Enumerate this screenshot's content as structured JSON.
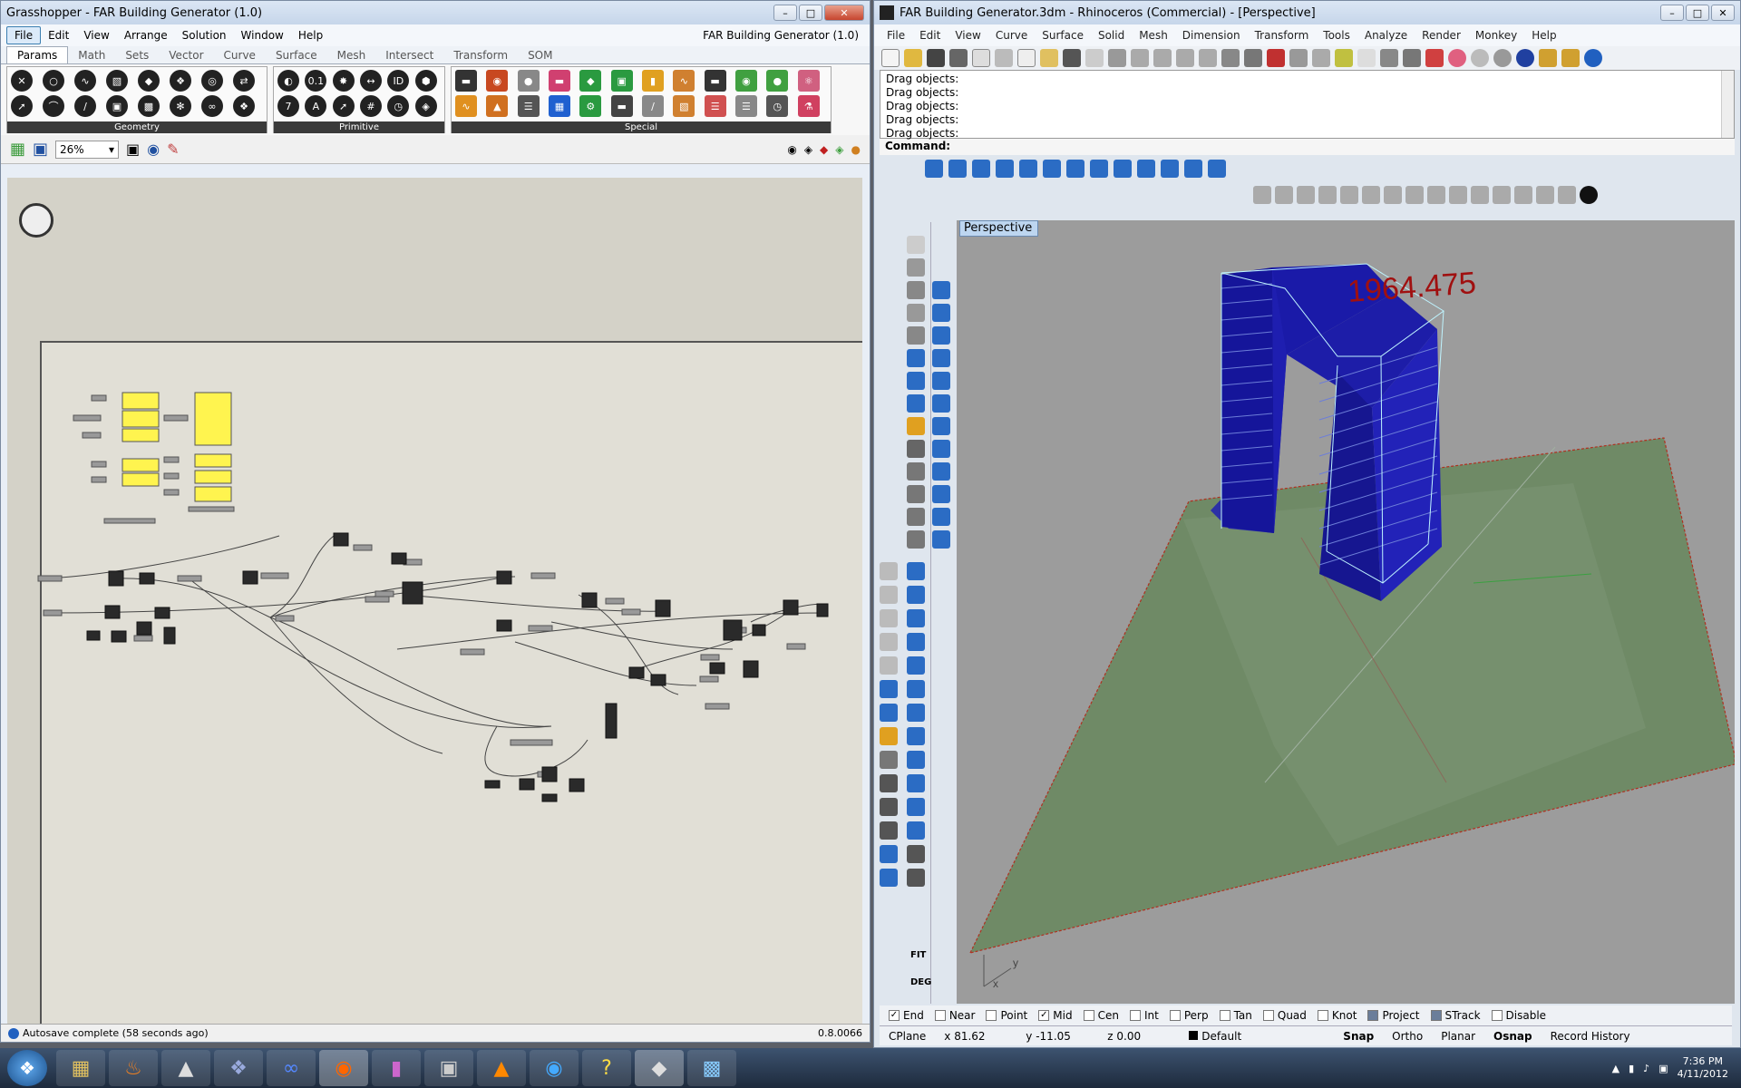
{
  "grasshopper": {
    "title": "Grasshopper - FAR Building Generator (1.0)",
    "doc_name": "FAR Building Generator (1.0)",
    "menu": [
      "File",
      "Edit",
      "View",
      "Arrange",
      "Solution",
      "Window",
      "Help"
    ],
    "tabs": [
      "Params",
      "Math",
      "Sets",
      "Vector",
      "Curve",
      "Surface",
      "Mesh",
      "Intersect",
      "Transform",
      "SOM"
    ],
    "ribbon_groups": [
      "Geometry",
      "Primitive",
      "Special"
    ],
    "zoom": "26%",
    "status": "Autosave complete (58 seconds ago)",
    "version": "0.8.0066"
  },
  "rhino": {
    "title": "FAR Building Generator.3dm - Rhinoceros (Commercial) - [Perspective]",
    "menu": [
      "File",
      "Edit",
      "View",
      "Curve",
      "Surface",
      "Solid",
      "Mesh",
      "Dimension",
      "Transform",
      "Tools",
      "Analyze",
      "Render",
      "Monkey",
      "Help"
    ],
    "history": [
      "Drag objects:",
      "Drag objects:",
      "Drag objects:",
      "Drag objects:",
      "Drag objects:"
    ],
    "command_label": "Command:",
    "viewport": "Perspective",
    "measure": "1964.475",
    "axis_y": "y",
    "axis_x": "x",
    "osnaps": [
      {
        "label": "End",
        "checked": true
      },
      {
        "label": "Near",
        "checked": false
      },
      {
        "label": "Point",
        "checked": false
      },
      {
        "label": "Mid",
        "checked": true
      },
      {
        "label": "Cen",
        "checked": false
      },
      {
        "label": "Int",
        "checked": false
      },
      {
        "label": "Perp",
        "checked": false
      },
      {
        "label": "Tan",
        "checked": false
      },
      {
        "label": "Quad",
        "checked": false
      },
      {
        "label": "Knot",
        "checked": false
      },
      {
        "label": "Project",
        "checked": false
      },
      {
        "label": "STrack",
        "checked": false
      },
      {
        "label": "Disable",
        "checked": false
      }
    ],
    "status": {
      "cplane": "CPlane",
      "x": "x 81.62",
      "y": "y -11.05",
      "z": "z 0.00",
      "layer": "Default",
      "snap": "Snap",
      "ortho": "Ortho",
      "planar": "Planar",
      "osnap": "Osnap",
      "record": "Record History"
    },
    "side_labels": [
      "FIT",
      "DEG"
    ]
  },
  "taskbar": {
    "time": "7:36 PM",
    "date": "4/11/2012"
  },
  "colors": {
    "building": "#1a1aa8",
    "ground": "#6f8a66",
    "viewport_bg": "#9c9c9c",
    "measure": "#a01010",
    "component": "#fff44f"
  }
}
